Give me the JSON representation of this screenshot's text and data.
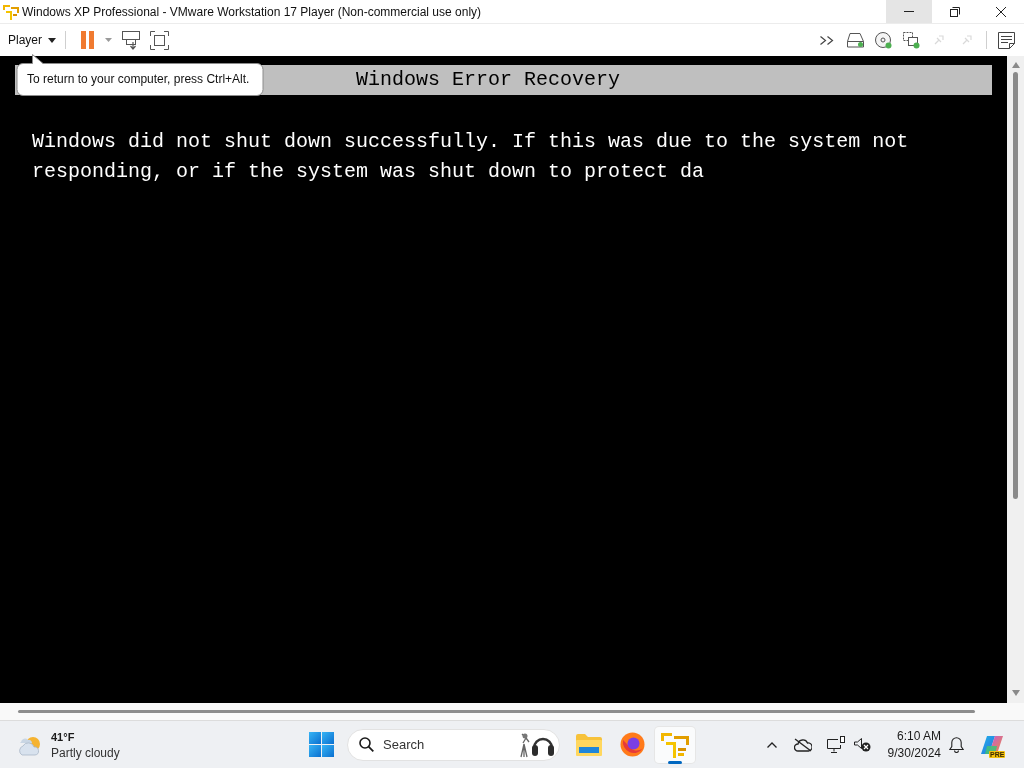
{
  "window": {
    "title": "Windows XP Professional - VMware Workstation 17 Player (Non-commercial use only)",
    "controls": [
      {
        "kind": "minimize",
        "hovered": true
      },
      {
        "kind": "restore",
        "hovered": false
      },
      {
        "kind": "close",
        "hovered": false
      }
    ]
  },
  "toolbar": {
    "menu": "Player",
    "devices": [
      {
        "kind": "hard-disk",
        "disabled": false
      },
      {
        "kind": "cd-drive",
        "disabled": false
      },
      {
        "kind": "network-adapter",
        "disabled": false
      },
      {
        "kind": "device",
        "disabled": true
      },
      {
        "kind": "device",
        "disabled": true
      }
    ]
  },
  "tooltip": {
    "text": "To return to your computer, press Ctrl+Alt."
  },
  "vm_screen": {
    "header": "Windows Error Recovery",
    "message": "Windows did not shut down successfully. If this was due to the system not responding, or if the system was shut down to protect da"
  },
  "taskbar": {
    "weather": {
      "temperature": "41°F",
      "condition": "Partly cloudy"
    },
    "search": {
      "placeholder": "Search"
    },
    "apps": [
      {
        "kind": "file-explorer",
        "active": false
      },
      {
        "kind": "firefox",
        "active": false
      },
      {
        "kind": "vmware",
        "active": true
      }
    ],
    "tray": {
      "sound_muted": true
    },
    "clock": {
      "time": "6:10 AM",
      "date": "9/30/2024"
    },
    "copilot": {
      "badge": "PRE"
    }
  }
}
